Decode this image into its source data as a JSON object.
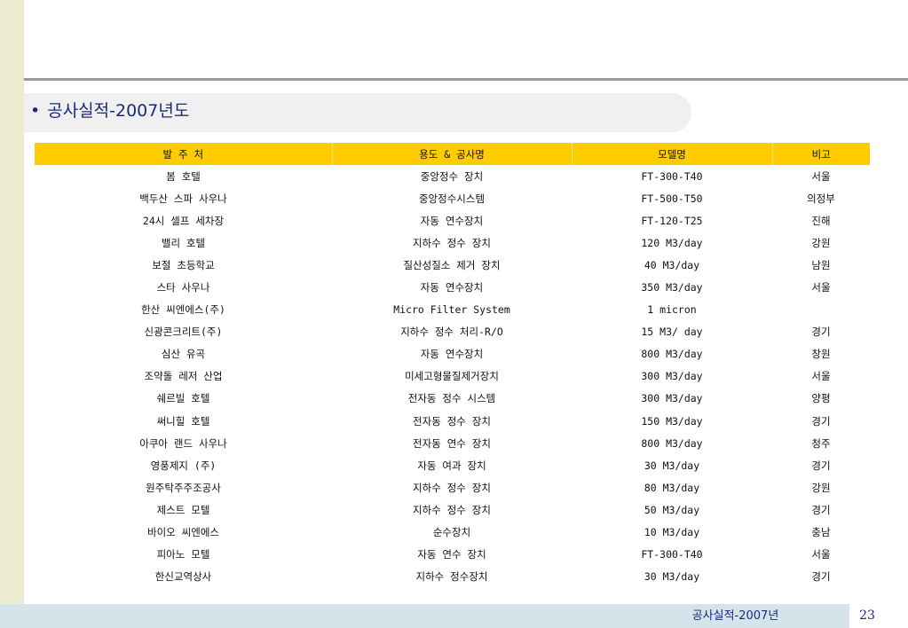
{
  "slide": {
    "title": "공사실적-2007년도",
    "bullet": "•"
  },
  "table": {
    "headers": [
      "발 주 처",
      "용도 & 공사명",
      "모델명",
      "비고"
    ],
    "rows": [
      [
        "봄 호텔",
        "중앙정수 장치",
        "FT-300-T40",
        "서울"
      ],
      [
        "백두산 스파 사우나",
        "중앙정수시스템",
        "FT-500-T50",
        "의정부"
      ],
      [
        "24시 셀프 세차장",
        "자동 연수장치",
        "FT-120-T25",
        "진해"
      ],
      [
        "밸리 호텔",
        "지하수 정수 장치",
        "120 M3/day",
        "강원"
      ],
      [
        "보절 초등학교",
        "질산성질소 제거 장치",
        "40 M3/day",
        "남원"
      ],
      [
        "스타 사우나",
        "자동 연수장치",
        "350 M3/day",
        "서울"
      ],
      [
        "한산 씨엔에스(주)",
        "Micro Filter System",
        "1 micron",
        ""
      ],
      [
        "신광콘크리트(주)",
        "지하수 정수 처리-R/O",
        "15 M3/ day",
        "경기"
      ],
      [
        "심산 유곡",
        "자동 연수장치",
        "800 M3/day",
        "창원"
      ],
      [
        "조약돌 레저 산업",
        "미세고형물질제거장치",
        "300 M3/day",
        "서울"
      ],
      [
        "쉐르빌 호텔",
        "전자동 정수 시스템",
        "300 M3/day",
        "양평"
      ],
      [
        "써니힐 호텔",
        "전자동 정수 장치",
        "150 M3/day",
        "경기"
      ],
      [
        "아쿠아 랜드 사우나",
        "전자동 연수 장치",
        "800 M3/day",
        "청주"
      ],
      [
        "영풍제지 (주)",
        "자동 여과 장치",
        "30 M3/day",
        "경기"
      ],
      [
        "원주탁주주조공사",
        "지하수 정수 장치",
        "80 M3/day",
        "강원"
      ],
      [
        "제스트 모텔",
        "지하수 정수 장치",
        "50 M3/day",
        "경기"
      ],
      [
        "바이오 씨엔에스",
        "순수장치",
        "10 M3/day",
        "충남"
      ],
      [
        "피아노 모텔",
        "자동 연수 장치",
        "FT-300-T40",
        "서울"
      ],
      [
        "한신교역상사",
        "지하수 정수장치",
        "30 M3/day",
        "경기"
      ]
    ]
  },
  "footer": {
    "label": "공사실적-2007년",
    "page": "23"
  },
  "colors": {
    "header_bg": "#ffcc00",
    "left_strip": "#ecebd0",
    "footer_bg": "#d5e3ea",
    "title_text": "#1a2a7a"
  }
}
